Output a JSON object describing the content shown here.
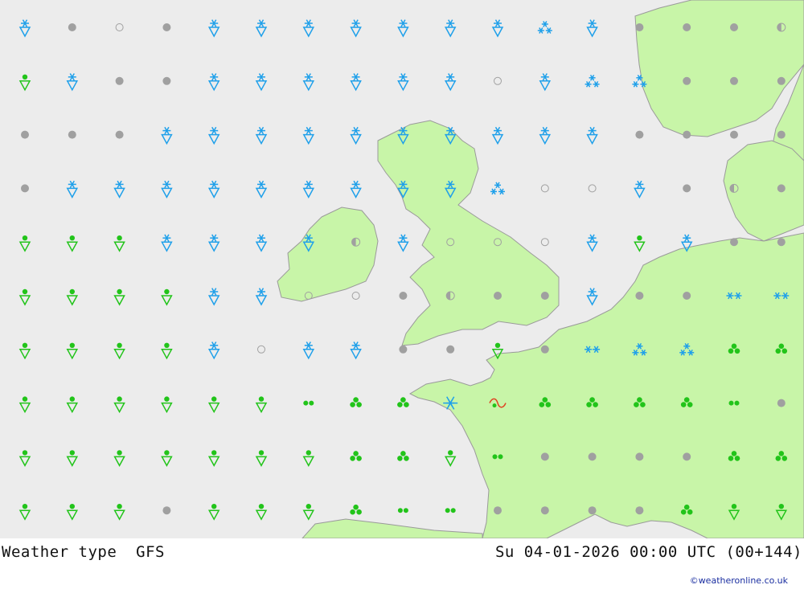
{
  "header": {
    "product_label": "Weather type",
    "model_label": "GFS",
    "datetime_label": "Su 04-01-2026 00:00 UTC (00+144)"
  },
  "credit": "©weatheronline.co.uk",
  "colors": {
    "sea": "#ececec",
    "land": "#c8f5a8",
    "coast": "#9a9a9a",
    "snow": "#1fa0ea",
    "rain": "#22c41a",
    "dry": "#a0a0a0",
    "mix": "#e04020"
  },
  "legend_symbols": {
    "snow-shower": "snow shower",
    "rain-shower": "rain shower",
    "dry": "no precipitation",
    "cloudy-dry": "overcast",
    "fair": "fair",
    "partly-cloudy": "partly cloudy",
    "heavy-snow": "heavy snow",
    "snow": "snow",
    "rain": "rain",
    "drizzle": "drizzle",
    "thunder-snow": "snow storm",
    "freezing": "sleet / freezing"
  },
  "grid": [
    [
      "snow-shower",
      "dry",
      "fair",
      "dry",
      "snow-shower",
      "snow-shower",
      "snow-shower",
      "snow-shower",
      "snow-shower",
      "snow-shower",
      "snow-shower",
      "heavy-snow",
      "snow-shower",
      "dry",
      "dry",
      "dry",
      "partly-cloudy"
    ],
    [
      "rain-shower",
      "snow-shower",
      "dry",
      "dry",
      "snow-shower",
      "snow-shower",
      "snow-shower",
      "snow-shower",
      "snow-shower",
      "snow-shower",
      "fair",
      "snow-shower",
      "heavy-snow",
      "heavy-snow",
      "dry",
      "dry",
      "dry"
    ],
    [
      "dry",
      "dry",
      "dry",
      "snow-shower",
      "snow-shower",
      "snow-shower",
      "snow-shower",
      "snow-shower",
      "snow-shower",
      "snow-shower",
      "snow-shower",
      "snow-shower",
      "snow-shower",
      "dry",
      "dry",
      "dry",
      "dry"
    ],
    [
      "dry",
      "snow-shower",
      "snow-shower",
      "snow-shower",
      "snow-shower",
      "snow-shower",
      "snow-shower",
      "snow-shower",
      "snow-shower",
      "snow-shower",
      "heavy-snow",
      "fair",
      "fair",
      "snow-shower",
      "dry",
      "partly-cloudy",
      "dry"
    ],
    [
      "rain-shower",
      "rain-shower",
      "rain-shower",
      "snow-shower",
      "snow-shower",
      "snow-shower",
      "snow-shower",
      "partly-cloudy",
      "snow-shower",
      "fair",
      "fair",
      "fair",
      "snow-shower",
      "rain-shower",
      "snow-shower",
      "dry",
      "dry"
    ],
    [
      "rain-shower",
      "rain-shower",
      "rain-shower",
      "rain-shower",
      "snow-shower",
      "snow-shower",
      "fair",
      "fair",
      "dry",
      "partly-cloudy",
      "dry",
      "dry",
      "snow-shower",
      "dry",
      "dry",
      "snow",
      "snow"
    ],
    [
      "rain-shower",
      "rain-shower",
      "rain-shower",
      "rain-shower",
      "snow-shower",
      "fair",
      "snow-shower",
      "snow-shower",
      "dry",
      "dry",
      "rain-shower",
      "dry",
      "snow",
      "heavy-snow",
      "heavy-snow",
      "rain",
      "rain"
    ],
    [
      "rain-shower",
      "rain-shower",
      "rain-shower",
      "rain-shower",
      "rain-shower",
      "rain-shower",
      "drizzle",
      "rain",
      "rain",
      "thunder-snow",
      "freezing",
      "rain",
      "rain",
      "rain",
      "rain",
      "drizzle",
      "dry"
    ],
    [
      "rain-shower",
      "rain-shower",
      "rain-shower",
      "rain-shower",
      "rain-shower",
      "rain-shower",
      "rain-shower",
      "rain",
      "rain",
      "rain-shower",
      "drizzle",
      "dry",
      "dry",
      "dry",
      "dry",
      "rain",
      "rain"
    ],
    [
      "rain-shower",
      "rain-shower",
      "rain-shower",
      "dry",
      "rain-shower",
      "rain-shower",
      "rain-shower",
      "rain",
      "drizzle",
      "drizzle",
      "dry",
      "dry",
      "dry",
      "dry",
      "rain",
      "rain-shower",
      "rain-shower"
    ]
  ]
}
